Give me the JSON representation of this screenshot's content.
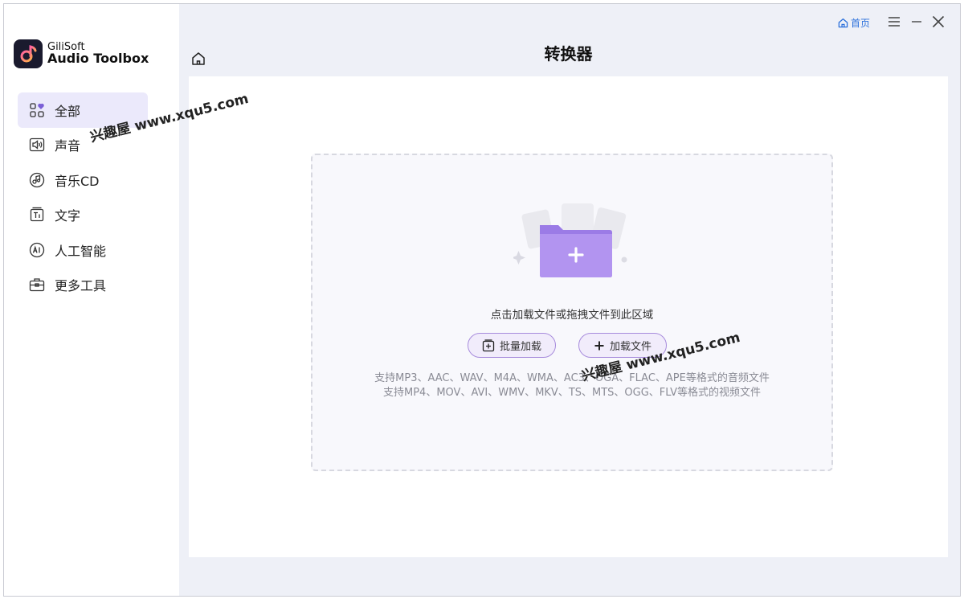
{
  "app": {
    "brand_line1": "GiliSoft",
    "brand_line2": "Audio Toolbox",
    "page_title": "转换器"
  },
  "titlebar": {
    "home_label": "首页",
    "icons": [
      "home-icon",
      "menu-icon",
      "minimize-icon",
      "close-icon"
    ]
  },
  "sidebar": {
    "items": [
      {
        "label": "全部",
        "icon": "grid-heart-icon",
        "active": true
      },
      {
        "label": "声音",
        "icon": "speaker-icon",
        "active": false
      },
      {
        "label": "音乐CD",
        "icon": "music-cd-icon",
        "active": false
      },
      {
        "label": "文字",
        "icon": "text-icon",
        "active": false
      },
      {
        "label": "人工智能",
        "icon": "ai-icon",
        "active": false
      },
      {
        "label": "更多工具",
        "icon": "toolbox-icon",
        "active": false
      }
    ]
  },
  "dropzone": {
    "hint": "点击加载文件或拖拽文件到此区域",
    "batch_button": "批量加载",
    "add_button": "加载文件",
    "formats_audio": "支持MP3、AAC、WAV、M4A、WMA、AC3、OGA、FLAC、APE等格式的音频文件",
    "formats_video": "支持MP4、MOV、AVI、WMV、MKV、TS、MTS、OGG、FLV等格式的视频文件"
  },
  "watermark": {
    "text1": "兴趣屋 www.xqu5.com",
    "text2": "兴趣屋 www.xqu5.com"
  },
  "colors": {
    "accent": "#7b5fd6",
    "link": "#2a6fdb",
    "active_bg": "#ebe9fb",
    "folder": "#b294f0"
  }
}
